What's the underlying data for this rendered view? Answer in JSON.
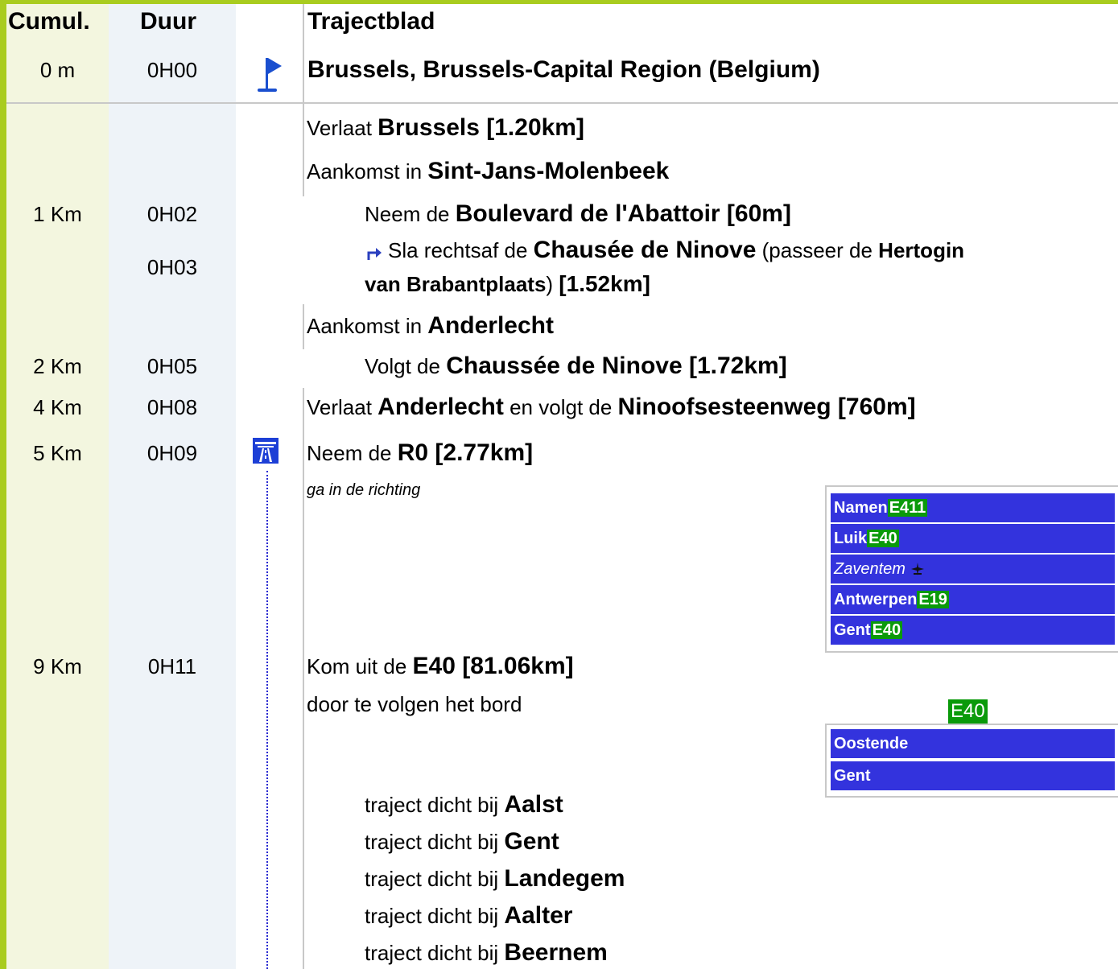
{
  "header": {
    "cumul_label": "Cumul.",
    "duur_label": "Duur",
    "title": "Trajectblad"
  },
  "start": {
    "cumul": "0 m",
    "duur": "0H00",
    "icon": "flag-icon",
    "place": "Brussels, Brussels-Capital Region (Belgium)"
  },
  "rows": {
    "r1": {
      "t1": "Verlaat ",
      "b1": "Brussels [1.20km]"
    },
    "r2": {
      "t1": "Aankomst in ",
      "b1": "Sint-Jans-Molenbeek"
    },
    "r3": {
      "cumul": "1 Km",
      "duur": "0H02",
      "t1": "Neem de ",
      "b1": "Boulevard de l'Abattoir [60m]"
    },
    "r4": {
      "duur": "0H03",
      "icon": "turn-right-icon",
      "t1": "Sla rechtsaf de ",
      "b1": "Chausée de Ninove",
      "t2": " (passeer de ",
      "b2": "Hertogin",
      "b3": "van Brabantplaats",
      "t3": ") ",
      "b4": "[1.52km]"
    },
    "r5": {
      "t1": "Aankomst in ",
      "b1": "Anderlecht"
    },
    "r6": {
      "cumul": "2 Km",
      "duur": "0H05",
      "t1": "Volgt de ",
      "b1": "Chaussée de Ninove [1.72km]"
    },
    "r7": {
      "cumul": "4 Km",
      "duur": "0H08",
      "t1": "Verlaat ",
      "b1": "Anderlecht",
      "t2": " en volgt de ",
      "b2": "Ninoofsesteenweg [760m]"
    },
    "r8": {
      "cumul": "5 Km",
      "duur": "0H09",
      "icon": "motorway-icon",
      "t1": "Neem de ",
      "b1": "R0 [2.77km]",
      "sub": "ga in de richting"
    },
    "r9": {
      "cumul": "9 Km",
      "duur": "0H11",
      "t1": "Kom uit de ",
      "b1": "E40 [81.06km]",
      "sub": "door te volgen het bord"
    }
  },
  "sign1": [
    {
      "name": "Namen",
      "road": "E411"
    },
    {
      "name": "Luik",
      "road": "E40"
    },
    {
      "name": "Zaventem",
      "road": "",
      "icon": "airplane-icon"
    },
    {
      "name": "Antwerpen",
      "road": "E19"
    },
    {
      "name": "Gent",
      "road": "E40"
    }
  ],
  "sign2": {
    "road": "E40",
    "dest1": "Oostende",
    "dest2": "Gent"
  },
  "near": {
    "prefix": "traject dicht bij ",
    "places": [
      "Aalst",
      "Gent",
      "Landegem",
      "Aalter",
      "Beernem"
    ]
  },
  "colors": {
    "border": "#a9cc1f",
    "cumul_bg": "#f3f6df",
    "duur_bg": "#eef3f8",
    "sign_blue": "#3333dd",
    "road_green": "#0a9a0a"
  }
}
